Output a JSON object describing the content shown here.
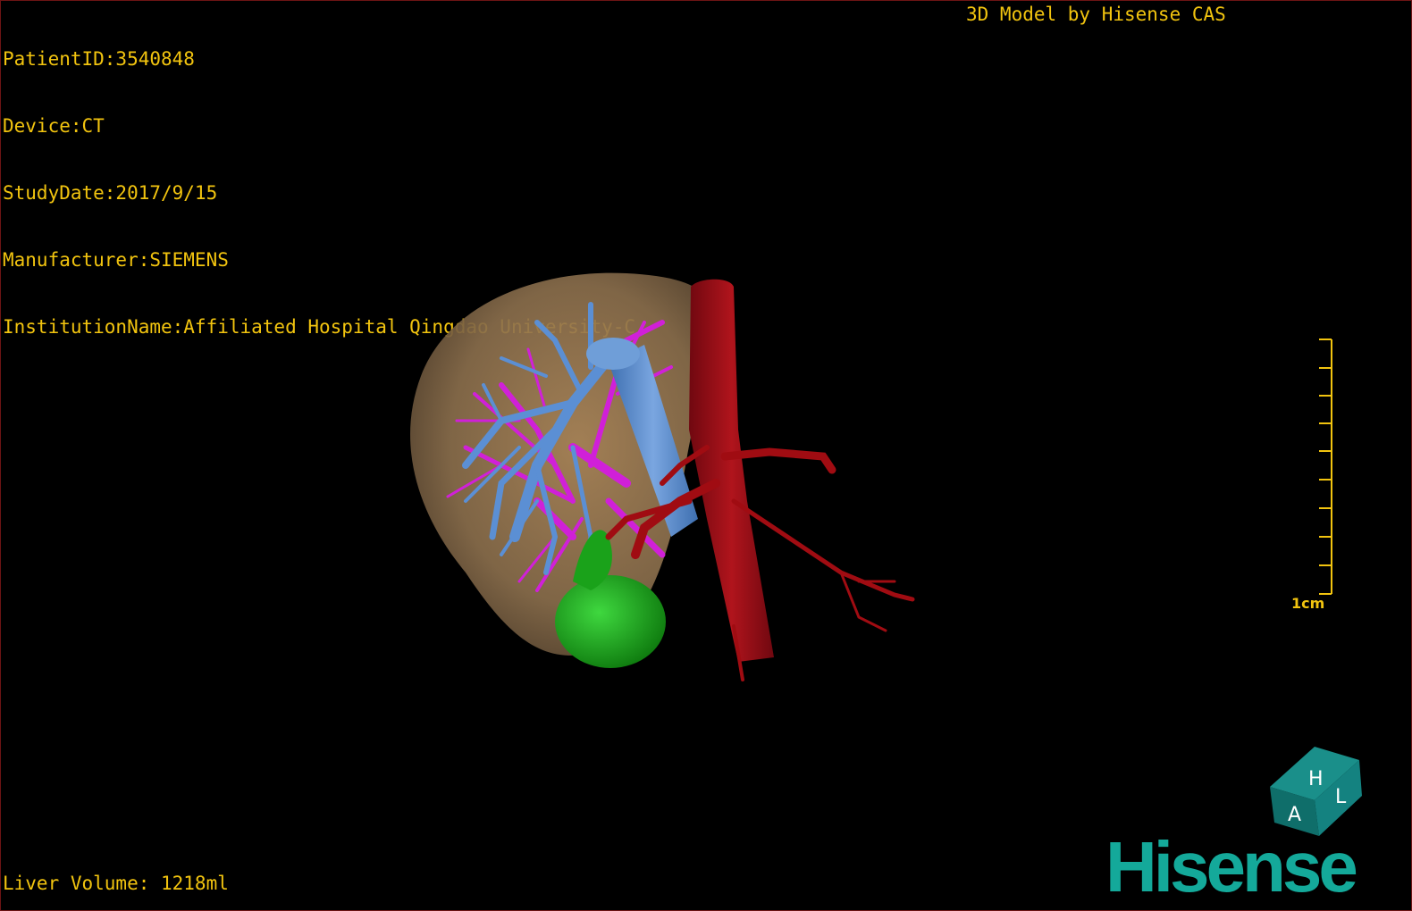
{
  "dicom": {
    "patient_id": "PatientID:3540848",
    "device": "Device:CT",
    "study_date": "StudyDate:2017/9/15",
    "manufacturer": "Manufacturer:SIEMENS",
    "institution": "InstitutionName:Affiliated Hospital Qingdao University-C"
  },
  "credit": "3D Model by Hisense CAS",
  "liver_volume": "Liver Volume: 1218ml",
  "scale": {
    "label": "1cm"
  },
  "orientation_cube": {
    "face_top": "H",
    "face_front": "A",
    "face_side": "L"
  },
  "brand": "Hisense",
  "colors": {
    "overlay_text": "#f2c40f",
    "liver": "#8a6e4c",
    "portal_vein": "#5b8fd4",
    "hepatic_vessels": "#d020d8",
    "artery": "#a00c12",
    "tumor": "#1aa21a",
    "brand": "#14a99a"
  }
}
